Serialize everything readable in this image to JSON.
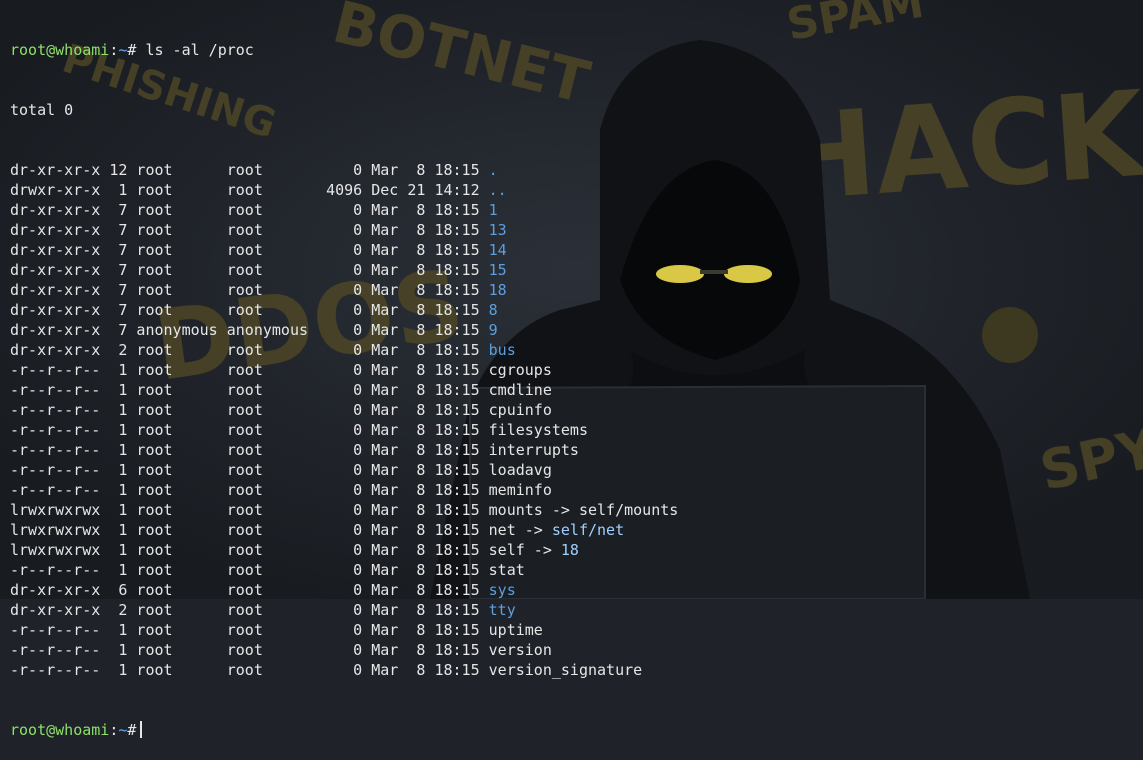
{
  "colors": {
    "background": "#1f2329",
    "prompt_user": "#8ee06a",
    "directory": "#5b9fe0",
    "link_target": "#9fd0ff",
    "text": "#e6e6e6",
    "graffiti": "#6b5f2a"
  },
  "background_words": [
    "BOTNET",
    "PHISHING",
    "SPAM",
    "HACK",
    "DDOS",
    "SPY"
  ],
  "prompt": {
    "user_host": "root@whoami",
    "cwd": "~",
    "symbol": "#"
  },
  "command": "ls -al /proc",
  "total_line": "total 0",
  "entries": [
    {
      "perms": "dr-xr-xr-x",
      "links": "12",
      "owner": "root",
      "group": "root",
      "size": "0",
      "month": "Mar",
      "day": "8",
      "time": "18:15",
      "name": ".",
      "kind": "dir",
      "target": ""
    },
    {
      "perms": "drwxr-xr-x",
      "links": "1",
      "owner": "root",
      "group": "root",
      "size": "4096",
      "month": "Dec",
      "day": "21",
      "time": "14:12",
      "name": "..",
      "kind": "dir",
      "target": ""
    },
    {
      "perms": "dr-xr-xr-x",
      "links": "7",
      "owner": "root",
      "group": "root",
      "size": "0",
      "month": "Mar",
      "day": "8",
      "time": "18:15",
      "name": "1",
      "kind": "dir",
      "target": ""
    },
    {
      "perms": "dr-xr-xr-x",
      "links": "7",
      "owner": "root",
      "group": "root",
      "size": "0",
      "month": "Mar",
      "day": "8",
      "time": "18:15",
      "name": "13",
      "kind": "dir",
      "target": ""
    },
    {
      "perms": "dr-xr-xr-x",
      "links": "7",
      "owner": "root",
      "group": "root",
      "size": "0",
      "month": "Mar",
      "day": "8",
      "time": "18:15",
      "name": "14",
      "kind": "dir",
      "target": ""
    },
    {
      "perms": "dr-xr-xr-x",
      "links": "7",
      "owner": "root",
      "group": "root",
      "size": "0",
      "month": "Mar",
      "day": "8",
      "time": "18:15",
      "name": "15",
      "kind": "dir",
      "target": ""
    },
    {
      "perms": "dr-xr-xr-x",
      "links": "7",
      "owner": "root",
      "group": "root",
      "size": "0",
      "month": "Mar",
      "day": "8",
      "time": "18:15",
      "name": "18",
      "kind": "dir",
      "target": ""
    },
    {
      "perms": "dr-xr-xr-x",
      "links": "7",
      "owner": "root",
      "group": "root",
      "size": "0",
      "month": "Mar",
      "day": "8",
      "time": "18:15",
      "name": "8",
      "kind": "dir",
      "target": ""
    },
    {
      "perms": "dr-xr-xr-x",
      "links": "7",
      "owner": "anonymous",
      "group": "anonymous",
      "size": "0",
      "month": "Mar",
      "day": "8",
      "time": "18:15",
      "name": "9",
      "kind": "dir",
      "target": ""
    },
    {
      "perms": "dr-xr-xr-x",
      "links": "2",
      "owner": "root",
      "group": "root",
      "size": "0",
      "month": "Mar",
      "day": "8",
      "time": "18:15",
      "name": "bus",
      "kind": "dir",
      "target": ""
    },
    {
      "perms": "-r--r--r--",
      "links": "1",
      "owner": "root",
      "group": "root",
      "size": "0",
      "month": "Mar",
      "day": "8",
      "time": "18:15",
      "name": "cgroups",
      "kind": "file",
      "target": ""
    },
    {
      "perms": "-r--r--r--",
      "links": "1",
      "owner": "root",
      "group": "root",
      "size": "0",
      "month": "Mar",
      "day": "8",
      "time": "18:15",
      "name": "cmdline",
      "kind": "file",
      "target": ""
    },
    {
      "perms": "-r--r--r--",
      "links": "1",
      "owner": "root",
      "group": "root",
      "size": "0",
      "month": "Mar",
      "day": "8",
      "time": "18:15",
      "name": "cpuinfo",
      "kind": "file",
      "target": ""
    },
    {
      "perms": "-r--r--r--",
      "links": "1",
      "owner": "root",
      "group": "root",
      "size": "0",
      "month": "Mar",
      "day": "8",
      "time": "18:15",
      "name": "filesystems",
      "kind": "file",
      "target": ""
    },
    {
      "perms": "-r--r--r--",
      "links": "1",
      "owner": "root",
      "group": "root",
      "size": "0",
      "month": "Mar",
      "day": "8",
      "time": "18:15",
      "name": "interrupts",
      "kind": "file",
      "target": ""
    },
    {
      "perms": "-r--r--r--",
      "links": "1",
      "owner": "root",
      "group": "root",
      "size": "0",
      "month": "Mar",
      "day": "8",
      "time": "18:15",
      "name": "loadavg",
      "kind": "file",
      "target": ""
    },
    {
      "perms": "-r--r--r--",
      "links": "1",
      "owner": "root",
      "group": "root",
      "size": "0",
      "month": "Mar",
      "day": "8",
      "time": "18:15",
      "name": "meminfo",
      "kind": "file",
      "target": ""
    },
    {
      "perms": "lrwxrwxrwx",
      "links": "1",
      "owner": "root",
      "group": "root",
      "size": "0",
      "month": "Mar",
      "day": "8",
      "time": "18:15",
      "name": "mounts",
      "kind": "link",
      "target": "self/mounts"
    },
    {
      "perms": "lrwxrwxrwx",
      "links": "1",
      "owner": "root",
      "group": "root",
      "size": "0",
      "month": "Mar",
      "day": "8",
      "time": "18:15",
      "name": "net",
      "kind": "link",
      "target": "self/net"
    },
    {
      "perms": "lrwxrwxrwx",
      "links": "1",
      "owner": "root",
      "group": "root",
      "size": "0",
      "month": "Mar",
      "day": "8",
      "time": "18:15",
      "name": "self",
      "kind": "link",
      "target": "18"
    },
    {
      "perms": "-r--r--r--",
      "links": "1",
      "owner": "root",
      "group": "root",
      "size": "0",
      "month": "Mar",
      "day": "8",
      "time": "18:15",
      "name": "stat",
      "kind": "file",
      "target": ""
    },
    {
      "perms": "dr-xr-xr-x",
      "links": "6",
      "owner": "root",
      "group": "root",
      "size": "0",
      "month": "Mar",
      "day": "8",
      "time": "18:15",
      "name": "sys",
      "kind": "dir",
      "target": ""
    },
    {
      "perms": "dr-xr-xr-x",
      "links": "2",
      "owner": "root",
      "group": "root",
      "size": "0",
      "month": "Mar",
      "day": "8",
      "time": "18:15",
      "name": "tty",
      "kind": "dir",
      "target": ""
    },
    {
      "perms": "-r--r--r--",
      "links": "1",
      "owner": "root",
      "group": "root",
      "size": "0",
      "month": "Mar",
      "day": "8",
      "time": "18:15",
      "name": "uptime",
      "kind": "file",
      "target": ""
    },
    {
      "perms": "-r--r--r--",
      "links": "1",
      "owner": "root",
      "group": "root",
      "size": "0",
      "month": "Mar",
      "day": "8",
      "time": "18:15",
      "name": "version",
      "kind": "file",
      "target": ""
    },
    {
      "perms": "-r--r--r--",
      "links": "1",
      "owner": "root",
      "group": "root",
      "size": "0",
      "month": "Mar",
      "day": "8",
      "time": "18:15",
      "name": "version_signature",
      "kind": "file",
      "target": ""
    }
  ]
}
